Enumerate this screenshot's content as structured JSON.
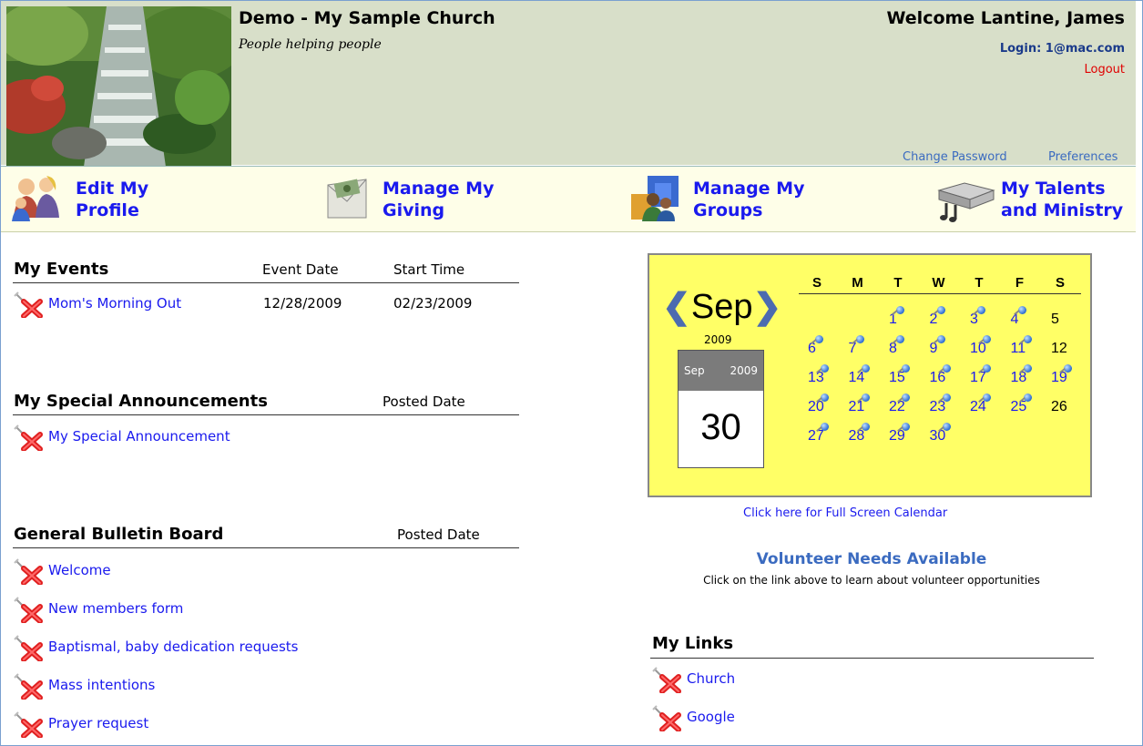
{
  "header": {
    "church_name": "Demo - My Sample Church",
    "tagline": "People helping people",
    "welcome": "Welcome Lantine, James",
    "login": "Login: 1@mac.com",
    "logout": "Logout",
    "change_password": "Change Password",
    "preferences": "Preferences"
  },
  "nav": {
    "edit_profile": [
      "Edit My",
      "Profile"
    ],
    "manage_giving": [
      "Manage My",
      "Giving"
    ],
    "manage_groups": [
      "Manage My",
      "Groups"
    ],
    "talents": [
      "My Talents",
      "and Ministry"
    ]
  },
  "events": {
    "title": "My Events",
    "col_date": "Event Date",
    "col_time": "Start Time",
    "rows": [
      {
        "name": "Mom's Morning Out",
        "date": "12/28/2009",
        "time": "02/23/2009"
      }
    ]
  },
  "announcements": {
    "title": "My Special Announcements",
    "col_date": "Posted Date",
    "rows": [
      {
        "name": "My Special Announcement"
      }
    ]
  },
  "bulletin": {
    "title": "General Bulletin Board",
    "col_date": "Posted Date",
    "rows": [
      {
        "name": "Welcome"
      },
      {
        "name": "New members form"
      },
      {
        "name": "Baptismal, baby dedication requests"
      },
      {
        "name": "Mass intentions"
      },
      {
        "name": "Prayer request"
      }
    ]
  },
  "calendar": {
    "month": "Sep",
    "year": "2009",
    "tearoff_month": "Sep",
    "tearoff_year": "2009",
    "today": "30",
    "days_of_week": [
      "S",
      "M",
      "T",
      "W",
      "T",
      "F",
      "S"
    ],
    "first_weekday": 2,
    "days_in_month": 30,
    "days_without_events": [
      5,
      12,
      26
    ],
    "full_screen_link": "Click here for Full Screen Calendar"
  },
  "volunteer": {
    "title": "Volunteer Needs Available",
    "subtitle": "Click on the link above to learn about volunteer opportunities"
  },
  "links": {
    "title": "My Links",
    "rows": [
      {
        "name": "Church"
      },
      {
        "name": "Google"
      }
    ]
  },
  "colors": {
    "header_bg": "#d8dfc9",
    "nav_bg": "#fefee8",
    "link": "#1a1aee",
    "calendar_bg": "#ffff66",
    "logout": "#e00000"
  }
}
